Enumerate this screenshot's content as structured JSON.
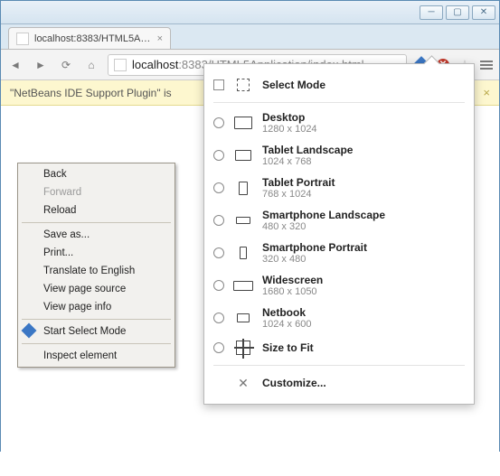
{
  "window": {
    "tab_title": "localhost:8383/HTML5Applicat",
    "url_display": "localhost:8383/HTML5Application/index.html",
    "url_host": "localhost",
    "url_path": ":8383/HTML5Application/index.html"
  },
  "infobar": {
    "text": "\"NetBeans IDE Support Plugin\" is"
  },
  "context_menu": {
    "back": "Back",
    "forward": "Forward",
    "reload": "Reload",
    "save_as": "Save as...",
    "print": "Print...",
    "translate": "Translate to English",
    "view_source": "View page source",
    "view_info": "View page info",
    "start_select": "Start Select Mode",
    "inspect": "Inspect element"
  },
  "popup": {
    "select_mode": "Select Mode",
    "devices": [
      {
        "name": "Desktop",
        "dims": "1280 x 1024"
      },
      {
        "name": "Tablet Landscape",
        "dims": "1024 x 768"
      },
      {
        "name": "Tablet Portrait",
        "dims": "768 x 1024"
      },
      {
        "name": "Smartphone Landscape",
        "dims": "480 x 320"
      },
      {
        "name": "Smartphone Portrait",
        "dims": "320 x 480"
      },
      {
        "name": "Widescreen",
        "dims": "1680 x 1050"
      },
      {
        "name": "Netbook",
        "dims": "1024 x 600"
      }
    ],
    "size_to_fit": "Size to Fit",
    "customize": "Customize..."
  }
}
